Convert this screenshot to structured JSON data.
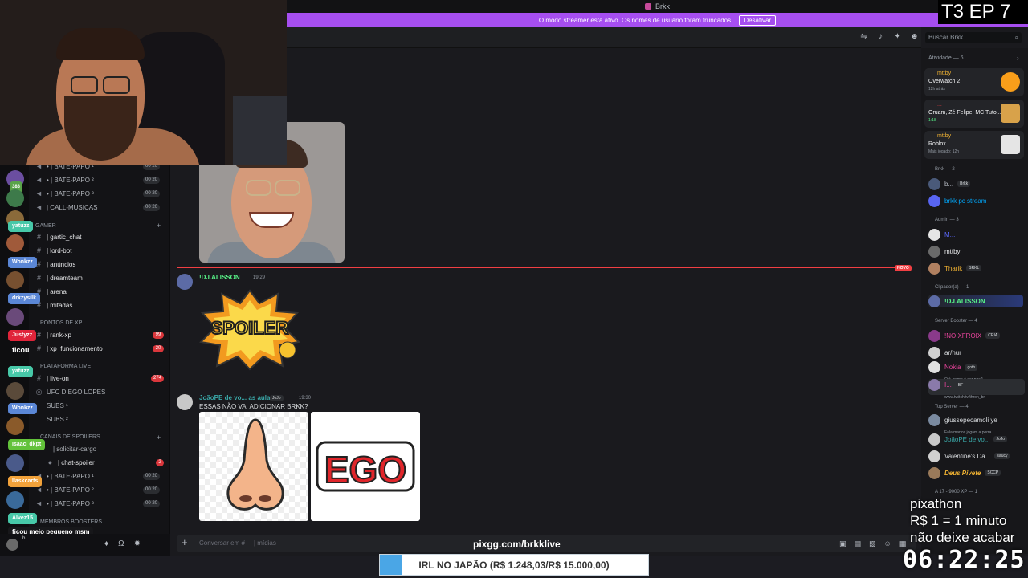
{
  "window": {
    "title": "Brkk"
  },
  "streamer_bar": {
    "text": "O modo streamer está ativo. Os nomes de usuário foram truncados.",
    "button": "Desativar"
  },
  "search": {
    "placeholder": "Buscar Brkk"
  },
  "overlay": {
    "episode": "T3 EP 7",
    "pix_lines": [
      "pixathon",
      "R$ 1 = 1 minuto",
      "não deixe acabar"
    ],
    "timer": "06:22:25",
    "url": "pixgg.com/brkklive",
    "goal": {
      "text": "IRL NO JAPÃO (R$ 1.248,03/R$ 15.000,00)",
      "current": 1248.03,
      "target": 15000.0
    }
  },
  "sidebar": {
    "channels_top": [
      {
        "label": "• | BATE-PAPO ¹",
        "pill": "00  20"
      },
      {
        "label": "• | BATE-PAPO ²",
        "pill": "00  20"
      },
      {
        "label": "• | BATE-PAPO ³",
        "pill": "00  20"
      },
      {
        "label": "| CALL-MUSICAS",
        "pill": "00  20"
      }
    ],
    "cat_gamer": "GAMER",
    "gamer_channels": [
      "| gartic_chat",
      "| lord-bot",
      "| anúncios",
      "| dreamteam",
      "| arena",
      "| mitadas"
    ],
    "cat_xp": "PONTOS DE XP",
    "xp_channels": [
      {
        "label": "| rank-xp",
        "badge": "99"
      },
      {
        "label": "| xp_funcionamento",
        "badge": "20"
      }
    ],
    "cat_live": "PLATAFORMA LIVE",
    "live_channels": [
      {
        "label": "| live-on",
        "badge": "274"
      },
      {
        "label": "UFC DIEGO LOPES"
      },
      {
        "label": "SUBS ¹"
      },
      {
        "label": "SUBS ²"
      }
    ],
    "cat_spoilers": "CANAIS DE SPOILERS",
    "spoiler_channels": [
      {
        "label": "| solicitar-cargo"
      },
      {
        "label": "| chat-spoiler",
        "badge": "2"
      },
      {
        "label": "• | BATE-PAPO ¹",
        "pill": "00  20"
      },
      {
        "label": "• | BATE-PAPO ²",
        "pill": "00  20"
      },
      {
        "label": "• | BATE-PAPO ³",
        "pill": "00  20"
      }
    ],
    "cat_boosters": "MEMBROS BOOSTERS",
    "rail_counts": [
      "383",
      "99"
    ],
    "rail_badges": [
      "yatuzz",
      "Wonkzz",
      "drkzysilk",
      "Justyzz",
      "ficou",
      "yatuzz",
      "Wonkzz",
      "Isaac_dkpt",
      "Ilaskcarts",
      "Alvez15"
    ],
    "rail_message": "ficou meio pequeno msm",
    "user_name": "b..."
  },
  "chat": {
    "messages": [
      {
        "author": "!DJ.ALISSON",
        "time": "19:29",
        "author_color": "#57f287",
        "sticker_text": "SPOILER"
      },
      {
        "author": "JoãoPE de vo... as aulas",
        "role": "JoJo",
        "time": "19:30",
        "text": "ESSAS NÃO VAI ADICIONAR BRKK?",
        "author_color": "#3aa8a8",
        "sticker_text": "EGO"
      }
    ],
    "new_label": "NOVO",
    "composer_placeholder": "Conversar em #",
    "composer_suffix": "| mídias"
  },
  "members": {
    "activity_title": "Atividade — 6",
    "activities": [
      {
        "user": "mttby",
        "game": "Overwatch 2",
        "sub": "12h atrás",
        "color": "#f99e1a"
      },
      {
        "user": "...",
        "game": "Oruam, Zé Felipe, MC Tuto,...",
        "sub": "1:18",
        "color": "#d8a24a"
      },
      {
        "user": "mttby",
        "game": "Roblox",
        "sub": "Mais jogado: 12h",
        "color": "#e5e5e5"
      }
    ],
    "groups": [
      {
        "header": "Brkk — 2",
        "members": [
          {
            "name": "b...",
            "tag": "Brkk",
            "color": "#b5bac1"
          },
          {
            "name": "brkk pc stream",
            "color": "#00a8fc"
          }
        ]
      },
      {
        "header": "Admin — 3",
        "members": [
          {
            "name": "M...",
            "color": "#5865f2"
          },
          {
            "name": "mttby",
            "color": "#e6e7e9"
          },
          {
            "name": "Tharik",
            "tag": "SRKL",
            "color": "#f0b232"
          }
        ]
      },
      {
        "header": "Clipador(a) — 1",
        "members": [
          {
            "name": "!DJ.ALISSON",
            "color": "#57f287"
          }
        ]
      },
      {
        "header": "Server Booster — 4",
        "members": [
          {
            "name": "!NOIXFROIX",
            "tag": "CRIA",
            "color": "#eb459e"
          },
          {
            "name": "ar/hur",
            "color": "#dbdee1"
          },
          {
            "name": "Nokia",
            "tag": "goth",
            "color": "#eb459e",
            "status": "Olá, como é ser npc?"
          },
          {
            "name": "I...",
            "tag": "BF",
            "color": "#eb459e",
            "status": "www.twitch.tv/thron_br"
          }
        ]
      },
      {
        "header": "Top Server — 4",
        "members": [
          {
            "name": "giussepecamoli ye",
            "color": "#dbdee1",
            "status": "Fala manos jogam a porra..."
          },
          {
            "name": "JoãoPE de vo...",
            "tag": "JoJo",
            "color": "#3aa8a8"
          },
          {
            "name": "Valentine's Da...",
            "tag": "saucy",
            "color": "#dbdee1"
          },
          {
            "name": "Deus Pivete",
            "tag": "SCCP",
            "color": "#f0b232"
          }
        ]
      }
    ],
    "last_header": "A 17 - 9000 XP — 1"
  },
  "colors": {
    "accent": "#a64ef0",
    "new": "#f23f43",
    "online": "#23a55a"
  }
}
